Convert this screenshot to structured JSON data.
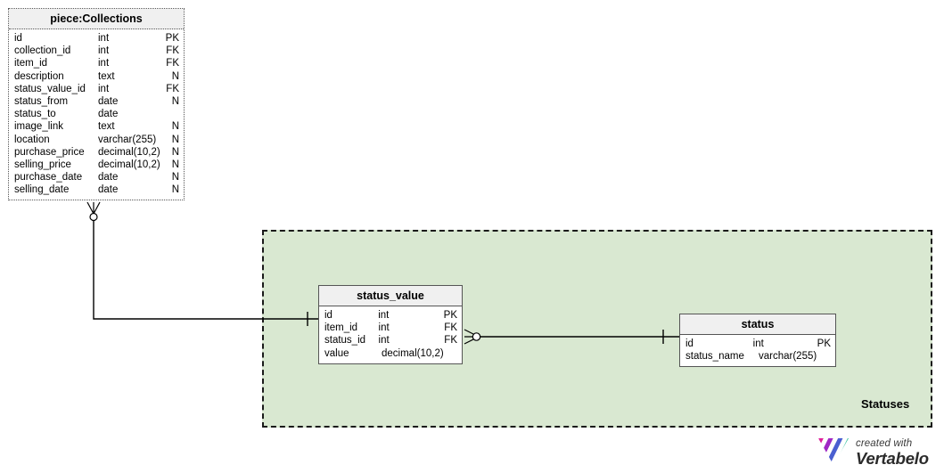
{
  "diagram": {
    "type": "entity-relationship-diagram",
    "background_color": "#ffffff"
  },
  "subject_area": {
    "label": "Statuses",
    "fill_color": "#d9e8d1",
    "border_color": "#1a1a1a",
    "border_style": "dashed"
  },
  "entities": [
    {
      "id": "piece_collections",
      "title": "piece:Collections",
      "border_style": "dotted",
      "header_color": "#f0f0f0",
      "attributes": [
        {
          "name": "id",
          "type": "int",
          "key": "PK"
        },
        {
          "name": "collection_id",
          "type": "int",
          "key": "FK"
        },
        {
          "name": "item_id",
          "type": "int",
          "key": "FK"
        },
        {
          "name": "description",
          "type": "text",
          "key": "N"
        },
        {
          "name": "status_value_id",
          "type": "int",
          "key": "FK"
        },
        {
          "name": "status_from",
          "type": "date",
          "key": "N"
        },
        {
          "name": "status_to",
          "type": "date",
          "key": ""
        },
        {
          "name": "image_link",
          "type": "text",
          "key": "N"
        },
        {
          "name": "location",
          "type": "varchar(255)",
          "key": "N"
        },
        {
          "name": "purchase_price",
          "type": "decimal(10,2)",
          "key": "N"
        },
        {
          "name": "selling_price",
          "type": "decimal(10,2)",
          "key": "N"
        },
        {
          "name": "purchase_date",
          "type": "date",
          "key": "N"
        },
        {
          "name": "selling_date",
          "type": "date",
          "key": "N"
        }
      ]
    },
    {
      "id": "status_value",
      "title": "status_value",
      "border_style": "solid",
      "header_color": "#f0f0f0",
      "attributes": [
        {
          "name": "id",
          "type": "int",
          "key": "PK"
        },
        {
          "name": "item_id",
          "type": "int",
          "key": "FK"
        },
        {
          "name": "status_id",
          "type": "int",
          "key": "FK"
        },
        {
          "name": "value",
          "type": "decimal(10,2)",
          "key": ""
        }
      ]
    },
    {
      "id": "status",
      "title": "status",
      "border_style": "solid",
      "header_color": "#f0f0f0",
      "attributes": [
        {
          "name": "id",
          "type": "int",
          "key": "PK"
        },
        {
          "name": "status_name",
          "type": "varchar(255)",
          "key": ""
        }
      ]
    }
  ],
  "relationships": [
    {
      "id": "rel_collections_status_value",
      "from_entity": "status_value",
      "to_entity": "piece_collections",
      "from_cardinality": "one",
      "to_cardinality": "zero-or-many"
    },
    {
      "id": "rel_status_value_status",
      "from_entity": "status_value",
      "to_entity": "status",
      "from_cardinality": "zero-or-many",
      "to_cardinality": "one"
    }
  ],
  "badge": {
    "created_with": "created with",
    "product": "Vertabelo",
    "logo_colors": [
      "#e0219b",
      "#8c2fc7",
      "#3b6fe0",
      "#1fc8a0",
      "#7ed321"
    ]
  }
}
